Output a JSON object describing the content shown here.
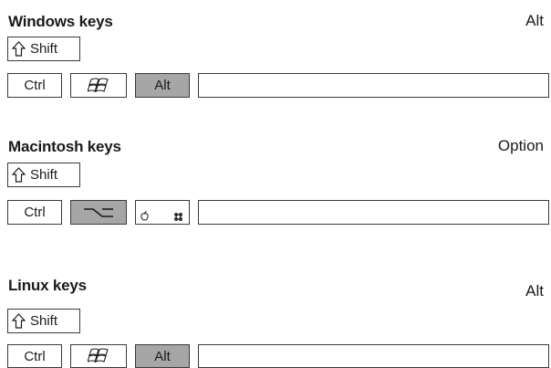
{
  "sections": [
    {
      "id": "windows",
      "heading": "Windows keys",
      "modifier": "Alt",
      "shift_label": "Shift",
      "ctrl_label": "Ctrl",
      "alt_label": "Alt",
      "logo_icon": "windows-logo-icon"
    },
    {
      "id": "mac",
      "heading": "Macintosh keys",
      "modifier": "Option",
      "shift_label": "Shift",
      "ctrl_label": "Ctrl",
      "option_icon": "option-key-icon",
      "command_icons": [
        "apple-icon",
        "command-icon"
      ]
    },
    {
      "id": "linux",
      "heading": "Linux keys",
      "modifier": "Alt",
      "shift_label": "Shift",
      "ctrl_label": "Ctrl",
      "alt_label": "Alt",
      "logo_icon": "windows-logo-icon"
    }
  ],
  "colors": {
    "pressed_key": "#a6a6a6",
    "key_border": "#3a3a3a"
  }
}
